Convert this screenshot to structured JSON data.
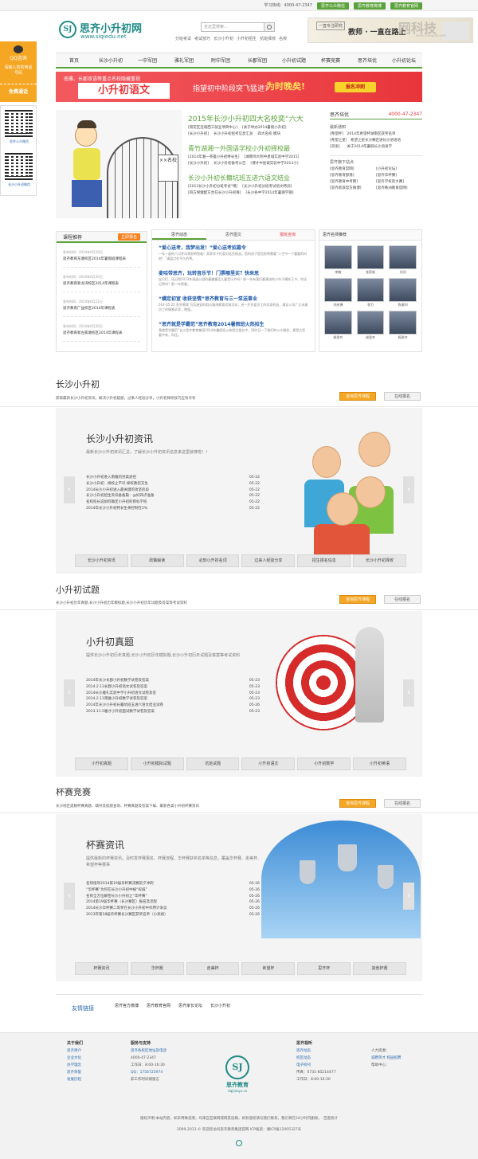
{
  "topbar": {
    "hotline": "学习热线：4000-47-2347",
    "links": [
      "思齐公众微信",
      "思齐教育微博",
      "思齐教育官网"
    ]
  },
  "header": {
    "logo_text": "思齐小升初网",
    "logo_url": "www.siqiedu.net",
    "logo_mark": "SJ",
    "search_placeholder": "在这里搜索...",
    "hotwords": [
      "分班考试",
      "考试技巧",
      "长沙小升初",
      "小升初招生",
      "抗班择校",
      "名校"
    ],
    "banner_tag": "一直专注研究",
    "banner_slogan": "教师 · 一直在路上"
  },
  "nav": [
    "首页",
    "长沙小升初",
    "一中军团",
    "雅礼军团",
    "附中军团",
    "长郡军团",
    "小升初试题",
    "杯赛竞赛",
    "思齐培优",
    "小升初论坛"
  ],
  "floatbar": {
    "title": "QQ咨询",
    "hint": "请输入您的电话号码",
    "action": "免费通话",
    "qr1_label": "思齐公众微信",
    "qr2_label": "长沙小升初微信"
  },
  "ad": {
    "top_line": "南雅、长郡双语等重点名校隐藏重视",
    "main": "小升初语文",
    "sub": "指望初中阶段突飞猛进?",
    "hook": "为时晚矣!",
    "cta": "报名冲刺"
  },
  "hero": {
    "sign": "××名校"
  },
  "headlines": [
    {
      "title": "2015年长沙小升初四大名校奕“六大",
      "rows": [
        "[雨花区连城西工就业项目中心]",
        "[关于举办2014暑假小升初]"
      ],
      "rows2": [
        "[长沙小升初]",
        "长沙小升初招考信息汇总",
        "四大名校 模块"
      ]
    },
    {
      "title": "青竹湖湘一外国语学校小升初择校最",
      "rows": [
        "[2014年湘一英雄小升初特长生]",
        "[湖南师大附中星城实验中学2015]"
      ],
      "rows2": [
        "[长沙小升初]",
        "长沙小升初备考公告",
        "[博才中星城实验中学2013小]"
      ]
    },
    {
      "title": "长沙小升初长籍坑班五进六语文结业",
      "rows": [
        "[2013长沙小升初分班考试“喂]",
        "[长沙小升初分班考试语文特训]"
      ],
      "rows2": [
        "[四方保健配方合在长沙小升初择]",
        "[长沙各中学2014年暑期学期]"
      ]
    }
  ],
  "right1": {
    "title": "思齐培优",
    "phone": "4000-47-2347",
    "notice_title": "最新通知",
    "notices": [
      "[希望杯]　2014年希望杯湖南区获奖名单",
      "[希望之星]　希望之星长沙赛区进长沙语语语",
      "[双语]　　关于2014年暑假长沙语语学"
    ],
    "links_title": "思齐旗下站点",
    "sites": [
      "[思齐教育官网]",
      "[小升初论坛]",
      "[思齐教育部落]",
      "[思齐华杯赛]",
      "[思齐教育中考网]",
      "[思齐学校的大赛]",
      "[思齐新浪官方微博]",
      "[思齐株洲教育官网]"
    ]
  },
  "course": {
    "title": "课程推荐",
    "badge": "立即报名",
    "items": [
      {
        "date": "发布时间：2014年6月19日",
        "name": "思齐教育东塘校区2014年暑假班课程表"
      },
      {
        "date": "发布时间：2014年6月20日",
        "name": "思齐教育新龙湾校区2014年课程表"
      },
      {
        "date": "发布时间：2014年6月21日",
        "name": "思齐教育广益校区2014年课程表"
      },
      {
        "date": "发布时间：2014年6月20日",
        "name": "思齐教育新左家塘校区2014年课程表"
      }
    ]
  },
  "dyn": {
    "tabs": [
      "思齐动态",
      "思齐图文",
      "报班咨询"
    ],
    "items": [
      {
        "h": "“爱心送考，我梦出发！”爱心送考招募令",
        "p": "一年一度的六月考试季即将到临！家家学子们面对这些挑战，您的孩子是否即将需要“人生中一个重要的时刻！”请盘点在不久的将。"
      },
      {
        "h": "麦咭带思齐，玩转音乐节！门票哪里买？快来思",
        "p": "宝贝们，还记得2013年清涵公园的童趣童话儿童音乐节吗？那一年有我们最潮流的小伙子模样王书，你还记得吗？那一年呢着。"
      },
      {
        "h": "“横定初宣 收获坚情”思齐教育与三一泵送事业",
        "p": "014-05-25 思齐教育 为实施党的群众路线教育实践活动，进一步关爱员工的切身利益，满足公司广大未婚员工的情感诉求，增强。"
      },
      {
        "h": "“思齐就是学霸范”思齐教育2014暑假班火热招生",
        "p": "我就是学霸范”长沙思齐教育集团2014年暑假班火热招生报名中，同时日一下我们的公众微信，更是大家看中来，你还。"
      }
    ]
  },
  "teachers": {
    "title": "思齐名师推荐",
    "names": [
      "李敏",
      "张家新",
      "刘洋",
      "刘彦博",
      "李力",
      "陈俊利",
      "胡思齐",
      "成思齐",
      "杨思齐"
    ]
  },
  "sec1": {
    "title": "长沙小升初",
    "desc": "获取最新长沙小升初资讯，解决小升初疑惑，过来人经验分享，小升初择校技巧应有尽有",
    "btn1": "咨询思齐课程",
    "btn2": "在线报名",
    "ptitle": "长沙小升初资讯",
    "pdesc": "最新长沙小升初资讯汇总，了解长沙小升初资讯信息来这里就够啦！！",
    "list": [
      [
        "长沙小升初进入南雅的另类途径",
        "05-22"
      ],
      [
        "长沙小升初：择校止不尽 择校教您又生",
        "05-22"
      ],
      [
        "2014长沙小升初进入最关键的攻坚阶段",
        "05-22"
      ],
      [
        "长沙小升初招生资讯备备篇：@好四点准备",
        "05-22"
      ],
      [
        "名校校长说如何确定小升初的目标学校",
        "05-22"
      ],
      [
        "2014年长沙小升初特长生将控制在5%",
        "05-22"
      ]
    ],
    "tabs": [
      "长沙小升初资讯",
      "政策解读",
      "必知小升初名词",
      "过来人经验分享",
      "招生报名信息",
      "长沙小升初择校"
    ]
  },
  "sec2": {
    "title": "小升初试题",
    "desc": "长沙小升初历年真题,长沙小升初历年模拟题,长沙小升初历年试题及答案等考试资料",
    "btn1": "咨询思齐课程",
    "btn2": "在线报名",
    "ptitle": "小升初真题",
    "pdesc": "提供长沙小升初历年真题,长沙小升初历年模拟题,长沙小升初历年试题及答案等考试资料",
    "list": [
      [
        "2014年长沙长郡小升初数学试卷及答案",
        "05-23"
      ],
      [
        "2014.2.13长郡小升初语文试卷及答案",
        "05-23"
      ],
      [
        "2014长沙雅礼实验中学小升初语文试卷及答",
        "05-23"
      ],
      [
        "2014.2.11南雅小升初数学试卷及答案",
        "05-23"
      ],
      [
        "2014年长沙小升初长籍坑班五进六语文结业试卷",
        "05-26"
      ],
      [
        "2013.11.5雅才小升初面试数学试卷及答案",
        "05-23"
      ]
    ],
    "tabs": [
      "小升初真题",
      "小升初模拟试题",
      "坑班试题",
      "小升初语文",
      "小升初数学",
      "小升初英语"
    ]
  },
  "sec3": {
    "title": "杯赛竞赛",
    "desc": "长沙地区奥数杯赛真题、辅导及成绩查询、杯赛真题及答案下载、最新各类小升初杯赛资讯",
    "btn1": "咨询思齐课程",
    "btn2": "在线报名",
    "ptitle": "杯赛资讯",
    "pdesc": "提供最新的杯赛资讯，及时发杯赛报名、杯赛流程、华杯赛获奖名单等信息，覆盖华杯赛、走美杯、希望杯等赛事",
    "list": [
      [
        "名师指导2014第19届华杯赛决赛前夕冲刺",
        "05-26"
      ],
      [
        "“华杯赛”为何在长沙小升初中被“权威”",
        "05-26"
      ],
      [
        "名师全方位解密长沙小升初之“华杯赛”",
        "05-26"
      ],
      [
        "2014第19届华杯赛（长沙赛区）报名及流程",
        "05-26"
      ],
      [
        "2014长沙华杯赛二等奖在长沙小升初中作用计争议",
        "05-26"
      ],
      [
        "2013年第18届华杯赛长沙赛区获奖名单（小高组）",
        "05-26"
      ]
    ],
    "tabs": [
      "杯赛资讯",
      "华杯赛",
      "走美杯",
      "希望杯",
      "思齐杯",
      "其他杯赛"
    ]
  },
  "friend": {
    "label": "友情链接",
    "links": [
      "思齐官方微博",
      "思齐教育官网",
      "思齐家长论坛",
      "长沙小升初"
    ]
  },
  "footer": {
    "col1_title": "关于我们",
    "col1": [
      "思齐简介",
      "企业文化",
      "办学理念",
      "思齐荣誉",
      "发展历程"
    ],
    "col2_title": "服务与支持",
    "col2": [
      "思齐各校区地址及电话",
      "4000-47-2347",
      "工作日：8:00-16:30",
      "QQ：1756725974",
      "非工作时间请留言"
    ],
    "logo_mark": "SJ",
    "logo_name": "思齐教育",
    "logo_url": "siqijiaoyu.cn",
    "col3_title": "思齐视听",
    "col3": [
      "思齐动态",
      "校区动态",
      "电子校刊",
      "传真：0731-85214477",
      "工作日：8:00-16:30"
    ],
    "col4": [
      "人力资源：",
      "诚聘英才",
      "校园招聘",
      "帮助中心："
    ],
    "copy1": "版权声明:本站内容，如未特殊说明，均来自互联网或网友投稿，如有侵权请与我们联系，我们将在24小时内删除。　百度统计",
    "copy2": "2009-2013 © 欢迎您访问思齐教育集团官网 ICP备案：湘ICP备12005327号"
  },
  "watermark": "网科技",
  "watermark_url": "www.sxwquan.com"
}
